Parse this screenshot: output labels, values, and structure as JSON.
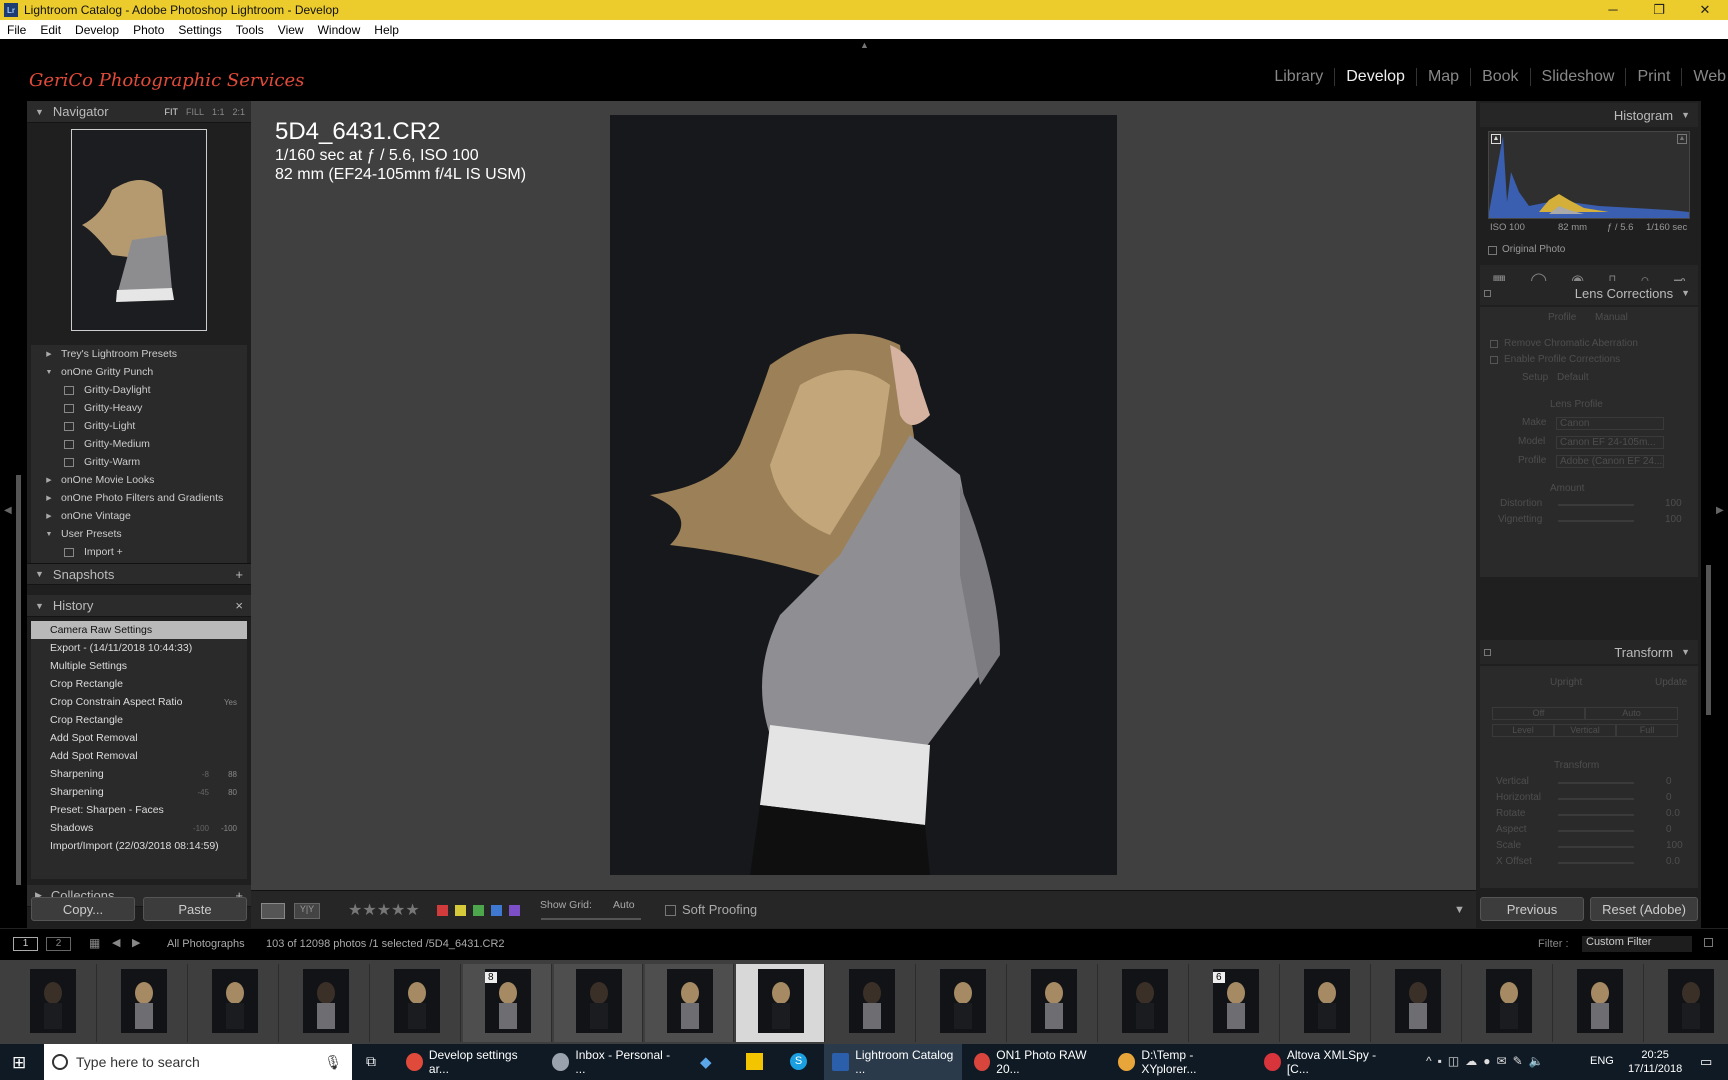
{
  "window": {
    "title": "Lightroom Catalog - Adobe Photoshop Lightroom - Develop",
    "app_badge": "Lr"
  },
  "menu": [
    "File",
    "Edit",
    "Develop",
    "Photo",
    "Settings",
    "Tools",
    "View",
    "Window",
    "Help"
  ],
  "brand": "GeriCo Photographic Services",
  "modules": [
    {
      "label": "Library",
      "active": false
    },
    {
      "label": "Develop",
      "active": true
    },
    {
      "label": "Map",
      "active": false
    },
    {
      "label": "Book",
      "active": false
    },
    {
      "label": "Slideshow",
      "active": false
    },
    {
      "label": "Print",
      "active": false
    },
    {
      "label": "Web",
      "active": false
    }
  ],
  "navigator": {
    "title": "Navigator",
    "options": [
      "FIT",
      "FILL",
      "1:1",
      "2:1"
    ]
  },
  "presets": [
    {
      "label": "Trey's Lightroom Presets",
      "type": "folder",
      "open": false
    },
    {
      "label": "onOne Gritty Punch",
      "type": "folder",
      "open": true
    },
    {
      "label": "Gritty-Daylight",
      "type": "preset"
    },
    {
      "label": "Gritty-Heavy",
      "type": "preset"
    },
    {
      "label": "Gritty-Light",
      "type": "preset"
    },
    {
      "label": "Gritty-Medium",
      "type": "preset"
    },
    {
      "label": "Gritty-Warm",
      "type": "preset"
    },
    {
      "label": "onOne Movie Looks",
      "type": "folder",
      "open": false
    },
    {
      "label": "onOne Photo Filters and Gradients",
      "type": "folder",
      "open": false
    },
    {
      "label": "onOne Vintage",
      "type": "folder",
      "open": false
    },
    {
      "label": "User Presets",
      "type": "folder",
      "open": true
    },
    {
      "label": "Import +",
      "type": "preset"
    }
  ],
  "snapshots": {
    "title": "Snapshots",
    "add": "+"
  },
  "history": {
    "title": "History",
    "close": "×",
    "items": [
      {
        "label": "Camera Raw Settings",
        "v1": "",
        "v2": "",
        "selected": true
      },
      {
        "label": "Export - (14/11/2018 10:44:33)",
        "v1": "",
        "v2": ""
      },
      {
        "label": "Multiple Settings",
        "v1": "",
        "v2": ""
      },
      {
        "label": "Crop Rectangle",
        "v1": "",
        "v2": ""
      },
      {
        "label": "Crop Constrain Aspect Ratio",
        "v1": "",
        "v2": "Yes"
      },
      {
        "label": "Crop Rectangle",
        "v1": "",
        "v2": ""
      },
      {
        "label": "Add Spot Removal",
        "v1": "",
        "v2": ""
      },
      {
        "label": "Add Spot Removal",
        "v1": "",
        "v2": ""
      },
      {
        "label": "Sharpening",
        "v1": "-8",
        "v2": "88"
      },
      {
        "label": "Sharpening",
        "v1": "-45",
        "v2": "80"
      },
      {
        "label": "Preset: Sharpen - Faces",
        "v1": "",
        "v2": ""
      },
      {
        "label": "Shadows",
        "v1": "-100",
        "v2": "-100"
      },
      {
        "label": "Import/Import (22/03/2018 08:14:59)",
        "v1": "",
        "v2": ""
      }
    ]
  },
  "collections": {
    "title": "Collections",
    "add": "+"
  },
  "left_buttons": {
    "copy": "Copy...",
    "paste": "Paste"
  },
  "photo_meta": {
    "filename": "5D4_6431.CR2",
    "exposure": "1/160 sec at ƒ / 5.6, ISO 100",
    "lens": "82 mm (EF24-105mm f/4L IS USM)"
  },
  "toolbar": {
    "show_grid_label": "Show Grid:",
    "show_grid_value": "Auto",
    "soft_proofing": "Soft Proofing",
    "stars": "★★★★★",
    "flag_colors": [
      "#d23b3b",
      "#d6c93a",
      "#4ca64c",
      "#3f78d1",
      "#7c4fc9"
    ]
  },
  "histogram": {
    "title": "Histogram",
    "iso": "ISO 100",
    "focal": "82 mm",
    "aperture": "ƒ / 5.6",
    "shutter": "1/160 sec",
    "original_photo": "Original Photo"
  },
  "lens_corrections": {
    "title": "Lens Corrections",
    "tabs": [
      "Profile",
      "Manual"
    ],
    "remove_ca": "Remove Chromatic Aberration",
    "enable_profile": "Enable Profile Corrections",
    "setup_label": "Setup",
    "setup_value": "Default",
    "lens_profile": "Lens Profile",
    "make_label": "Make",
    "make_value": "Canon",
    "model_label": "Model",
    "model_value": "Canon EF 24-105m...",
    "profile_label": "Profile",
    "profile_value": "Adobe (Canon EF 24...",
    "amount": "Amount",
    "distortion_label": "Distortion",
    "distortion_value": "100",
    "vignetting_label": "Vignetting",
    "vignetting_value": "100"
  },
  "transform": {
    "title": "Transform",
    "upright": "Upright",
    "update": "Update",
    "buttons": [
      "Off",
      "Auto",
      "Level",
      "Vertical",
      "Full"
    ],
    "section": "Transform",
    "sliders": [
      {
        "label": "Vertical",
        "value": "0"
      },
      {
        "label": "Horizontal",
        "value": "0"
      },
      {
        "label": "Rotate",
        "value": "0.0"
      },
      {
        "label": "Aspect",
        "value": "0"
      },
      {
        "label": "Scale",
        "value": "100"
      },
      {
        "label": "X Offset",
        "value": "0.0"
      }
    ]
  },
  "right_buttons": {
    "previous": "Previous",
    "reset": "Reset (Adobe)"
  },
  "filmbar": {
    "page1": "1",
    "page2": "2",
    "source": "All Photographs",
    "count": "103 of 12098 photos /1 selected /5D4_6431.CR2",
    "filter_label": "Filter :",
    "filter_value": "Custom Filter"
  },
  "filmstrip": {
    "count": 19,
    "selected_index": 8,
    "badges": [
      {
        "index": 5,
        "text": "8"
      },
      {
        "index": 13,
        "text": "6"
      }
    ]
  },
  "taskbar": {
    "search_placeholder": "Type here to search",
    "apps": [
      {
        "label": "Develop settings ar...",
        "color": "#e04a3a"
      },
      {
        "label": "Inbox - Personal - ...",
        "color": "#9aa3ad"
      },
      {
        "label": "Lightroom Catalog ...",
        "color": "#2b5eab"
      },
      {
        "label": "ON1 Photo RAW 20...",
        "color": "#d8453c"
      },
      {
        "label": "D:\\Temp - XYplorer...",
        "color": "#e8a53a"
      },
      {
        "label": "Altova XMLSpy - [C...",
        "color": "#d8343c"
      }
    ],
    "lang": "ENG",
    "time": "20:25",
    "date": "17/11/2018"
  }
}
